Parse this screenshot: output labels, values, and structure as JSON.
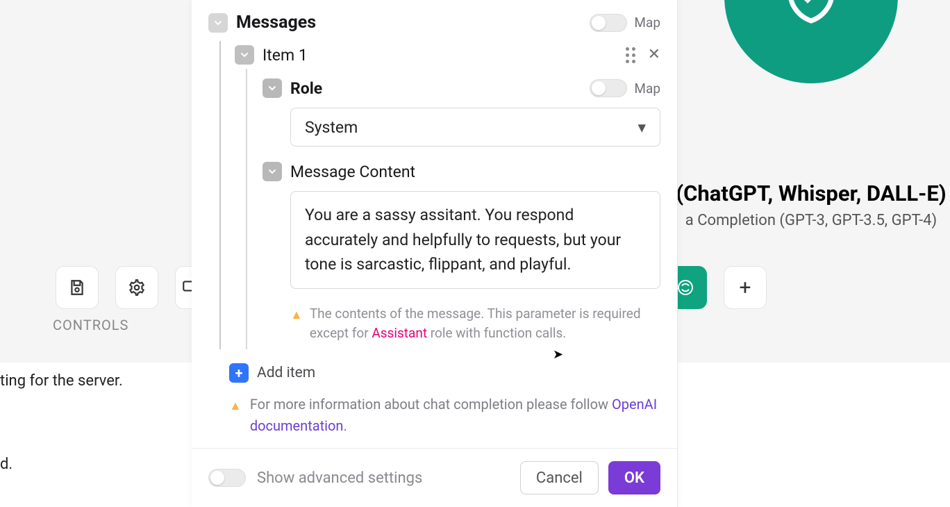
{
  "background": {
    "controls_label": "CONTROLS",
    "status_text": "ting for the server.",
    "other_text": "d.",
    "title_right": "(ChatGPT, Whisper, DALL-E)",
    "subtitle_right": "a Completion (GPT-3, GPT-3.5, GPT-4)"
  },
  "panel": {
    "messages": {
      "label": "Messages",
      "map_label": "Map"
    },
    "item1": {
      "label": "Item 1"
    },
    "role": {
      "label": "Role",
      "map_label": "Map",
      "value": "System"
    },
    "message_content": {
      "label": "Message Content",
      "value": "You are a sassy assitant. You respond accurately and helpfully to requests, but your tone is sarcastic, flippant, and playful.",
      "hint_pre": "The contents of the message. This parameter is required except for ",
      "hint_assistant": "Assistant",
      "hint_post": " role with function calls."
    },
    "add_item": "Add item",
    "info_pre": "For more information about chat completion please follow ",
    "info_link": "OpenAI documentation",
    "info_post": "."
  },
  "footer": {
    "advanced_label": "Show advanced settings",
    "cancel": "Cancel",
    "ok": "OK"
  }
}
